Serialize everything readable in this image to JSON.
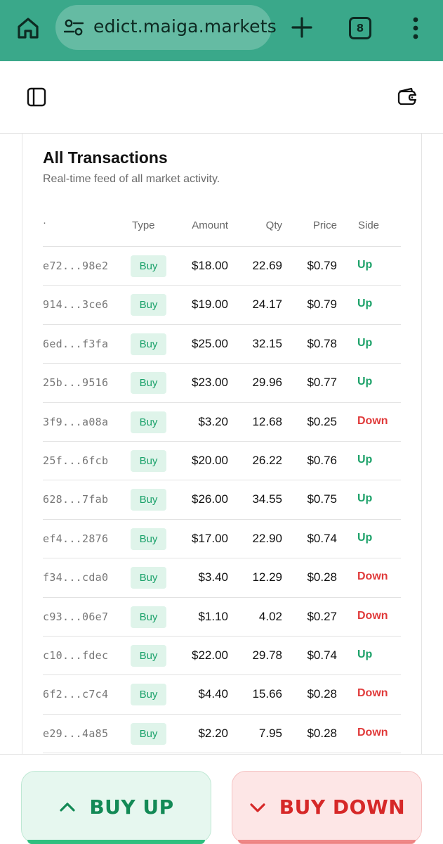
{
  "browser": {
    "url": "edict.maiga.markets",
    "tab_count": "8",
    "bar_color": "#3aa88a"
  },
  "header": {
    "left_icon": "sidebar-toggle-icon",
    "right_icon": "wallet-icon"
  },
  "transactions": {
    "title": "All Transactions",
    "subtitle": "Real-time feed of all market activity.",
    "columns": {
      "id": "·",
      "type": "Type",
      "amount": "Amount",
      "qty": "Qty",
      "price": "Price",
      "side": "Side"
    },
    "rows": [
      {
        "hash": "e72...98e2",
        "type": "Buy",
        "amount": "$18.00",
        "qty": "22.69",
        "price": "$0.79",
        "side": "Up"
      },
      {
        "hash": "914...3ce6",
        "type": "Buy",
        "amount": "$19.00",
        "qty": "24.17",
        "price": "$0.79",
        "side": "Up"
      },
      {
        "hash": "6ed...f3fa",
        "type": "Buy",
        "amount": "$25.00",
        "qty": "32.15",
        "price": "$0.78",
        "side": "Up"
      },
      {
        "hash": "25b...9516",
        "type": "Buy",
        "amount": "$23.00",
        "qty": "29.96",
        "price": "$0.77",
        "side": "Up"
      },
      {
        "hash": "3f9...a08a",
        "type": "Buy",
        "amount": "$3.20",
        "qty": "12.68",
        "price": "$0.25",
        "side": "Down"
      },
      {
        "hash": "25f...6fcb",
        "type": "Buy",
        "amount": "$20.00",
        "qty": "26.22",
        "price": "$0.76",
        "side": "Up"
      },
      {
        "hash": "628...7fab",
        "type": "Buy",
        "amount": "$26.00",
        "qty": "34.55",
        "price": "$0.75",
        "side": "Up"
      },
      {
        "hash": "ef4...2876",
        "type": "Buy",
        "amount": "$17.00",
        "qty": "22.90",
        "price": "$0.74",
        "side": "Up"
      },
      {
        "hash": "f34...cda0",
        "type": "Buy",
        "amount": "$3.40",
        "qty": "12.29",
        "price": "$0.28",
        "side": "Down"
      },
      {
        "hash": "c93...06e7",
        "type": "Buy",
        "amount": "$1.10",
        "qty": "4.02",
        "price": "$0.27",
        "side": "Down"
      },
      {
        "hash": "c10...fdec",
        "type": "Buy",
        "amount": "$22.00",
        "qty": "29.78",
        "price": "$0.74",
        "side": "Up"
      },
      {
        "hash": "6f2...c7c4",
        "type": "Buy",
        "amount": "$4.40",
        "qty": "15.66",
        "price": "$0.28",
        "side": "Down"
      },
      {
        "hash": "e29...4a85",
        "type": "Buy",
        "amount": "$2.20",
        "qty": "7.95",
        "price": "$0.28",
        "side": "Down"
      }
    ]
  },
  "actions": {
    "buy_up_label": "BUY UP",
    "buy_down_label": "BUY DOWN",
    "up_color": "#138a56",
    "down_color": "#d62828"
  }
}
